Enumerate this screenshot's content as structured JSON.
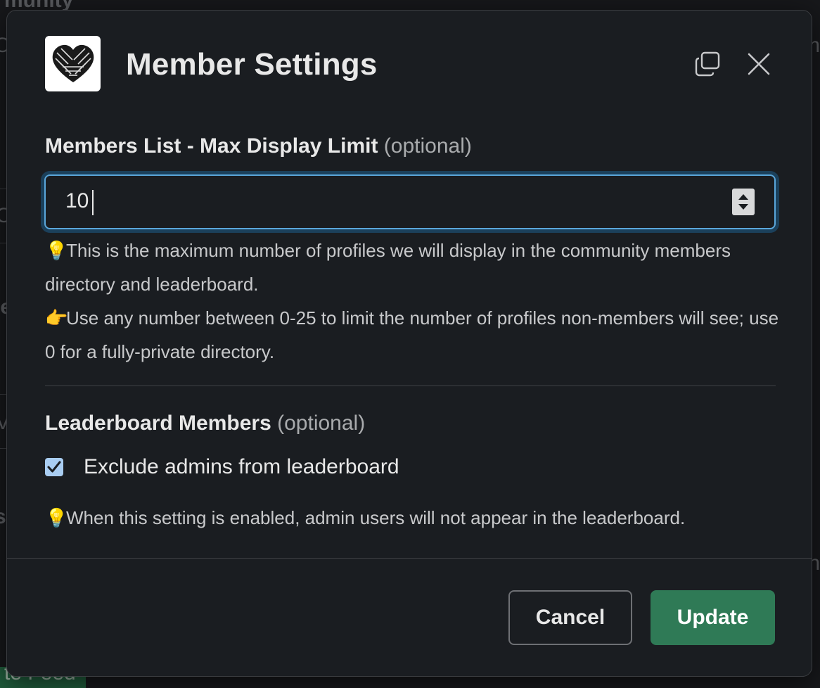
{
  "background": {
    "fragments": [
      "munity",
      "Co",
      "m",
      "C",
      "le",
      "g",
      "V",
      "s",
      "g",
      "o",
      "ch"
    ],
    "green_tab_label": "te Feed"
  },
  "modal": {
    "title": "Member Settings",
    "logo_icon": "heart-rope-logo",
    "copy_icon": "duplicate-window-icon",
    "close_icon": "close-icon"
  },
  "max_display": {
    "label": "Members List - Max Display Limit",
    "optional": "(optional)",
    "value": "10",
    "hint1_emoji": "💡",
    "hint1": "This is the maximum number of profiles we will display in the community members directory and leaderboard.",
    "hint2_emoji": "👉",
    "hint2": "Use any number between 0-25 to limit the number of profiles non-members will see; use 0 for a fully-private directory."
  },
  "leaderboard": {
    "label": "Leaderboard Members",
    "optional": "(optional)",
    "checkbox_label": "Exclude admins from leaderboard",
    "checked": true,
    "hint_emoji": "💡",
    "hint": "When this setting is enabled, admin users will not appear in the leaderboard."
  },
  "footer": {
    "cancel_label": "Cancel",
    "update_label": "Update"
  },
  "colors": {
    "modal_bg": "#1a1d21",
    "focus_ring": "#5aa6da",
    "primary_button": "#2f7a56",
    "checkbox_fill": "#a9cdf2"
  }
}
